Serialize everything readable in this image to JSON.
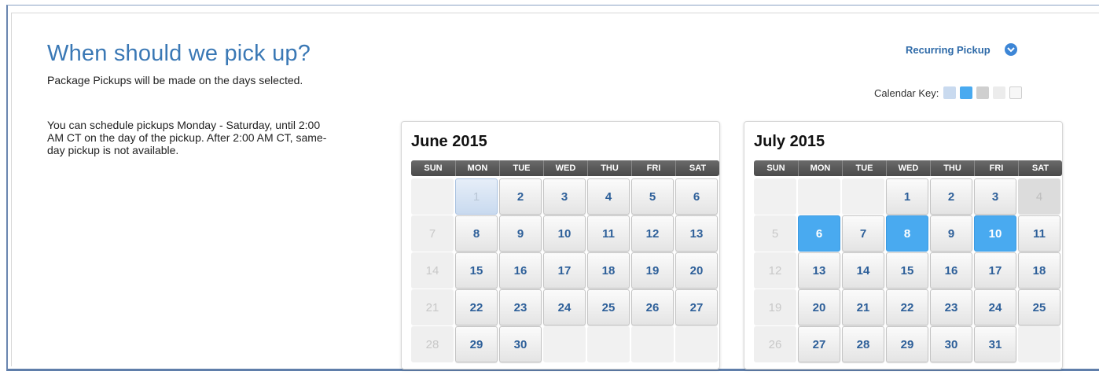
{
  "header": {
    "title": "When should we pick up?",
    "info_line1": "Package Pickups will be made on the days selected.",
    "info_line2": "You can schedule pickups Monday - Saturday, until 2:00 AM CT on the day of the pickup. After 2:00 AM CT, same-day pickup is not available."
  },
  "recurring": {
    "label": "Recurring Pickup",
    "icon": "chevron-down-circle-icon",
    "color": "#3d86d6"
  },
  "calendar_key": {
    "label": "Calendar Key:",
    "swatches": [
      "#c9daef",
      "#49aaf0",
      "#cfcfcf",
      "#ececec",
      "#f7f7f7"
    ]
  },
  "weekdays": [
    "SUN",
    "MON",
    "TUE",
    "WED",
    "THU",
    "FRI",
    "SAT"
  ],
  "calendars": [
    {
      "title": "June 2015",
      "days": [
        {
          "n": "1",
          "s": "today"
        },
        {
          "n": "2",
          "s": "avail"
        },
        {
          "n": "3",
          "s": "avail"
        },
        {
          "n": "4",
          "s": "avail"
        },
        {
          "n": "5",
          "s": "avail"
        },
        {
          "n": "6",
          "s": "avail"
        },
        {
          "n": "7",
          "s": "past"
        },
        {
          "n": "8",
          "s": "avail"
        },
        {
          "n": "9",
          "s": "avail"
        },
        {
          "n": "10",
          "s": "avail"
        },
        {
          "n": "11",
          "s": "avail"
        },
        {
          "n": "12",
          "s": "avail"
        },
        {
          "n": "13",
          "s": "avail"
        },
        {
          "n": "14",
          "s": "past"
        },
        {
          "n": "15",
          "s": "avail"
        },
        {
          "n": "16",
          "s": "avail"
        },
        {
          "n": "17",
          "s": "avail"
        },
        {
          "n": "18",
          "s": "avail"
        },
        {
          "n": "19",
          "s": "avail"
        },
        {
          "n": "20",
          "s": "avail"
        },
        {
          "n": "21",
          "s": "past"
        },
        {
          "n": "22",
          "s": "avail"
        },
        {
          "n": "23",
          "s": "avail"
        },
        {
          "n": "24",
          "s": "avail"
        },
        {
          "n": "25",
          "s": "avail"
        },
        {
          "n": "26",
          "s": "avail"
        },
        {
          "n": "27",
          "s": "avail"
        },
        {
          "n": "28",
          "s": "past"
        },
        {
          "n": "29",
          "s": "avail"
        },
        {
          "n": "30",
          "s": "avail"
        }
      ],
      "leading_blanks": 1
    },
    {
      "title": "July 2015",
      "days": [
        {
          "n": "1",
          "s": "avail"
        },
        {
          "n": "2",
          "s": "avail"
        },
        {
          "n": "3",
          "s": "avail"
        },
        {
          "n": "4",
          "s": "holiday"
        },
        {
          "n": "5",
          "s": "past"
        },
        {
          "n": "6",
          "s": "selected"
        },
        {
          "n": "7",
          "s": "avail"
        },
        {
          "n": "8",
          "s": "selected"
        },
        {
          "n": "9",
          "s": "avail"
        },
        {
          "n": "10",
          "s": "selected"
        },
        {
          "n": "11",
          "s": "avail"
        },
        {
          "n": "12",
          "s": "past"
        },
        {
          "n": "13",
          "s": "avail"
        },
        {
          "n": "14",
          "s": "avail"
        },
        {
          "n": "15",
          "s": "avail"
        },
        {
          "n": "16",
          "s": "avail"
        },
        {
          "n": "17",
          "s": "avail"
        },
        {
          "n": "18",
          "s": "avail"
        },
        {
          "n": "19",
          "s": "past"
        },
        {
          "n": "20",
          "s": "avail"
        },
        {
          "n": "21",
          "s": "avail"
        },
        {
          "n": "22",
          "s": "avail"
        },
        {
          "n": "23",
          "s": "avail"
        },
        {
          "n": "24",
          "s": "avail"
        },
        {
          "n": "25",
          "s": "avail"
        },
        {
          "n": "26",
          "s": "past"
        },
        {
          "n": "27",
          "s": "avail"
        },
        {
          "n": "28",
          "s": "avail"
        },
        {
          "n": "29",
          "s": "avail"
        },
        {
          "n": "30",
          "s": "avail"
        },
        {
          "n": "31",
          "s": "avail"
        }
      ],
      "leading_blanks": 3
    }
  ]
}
